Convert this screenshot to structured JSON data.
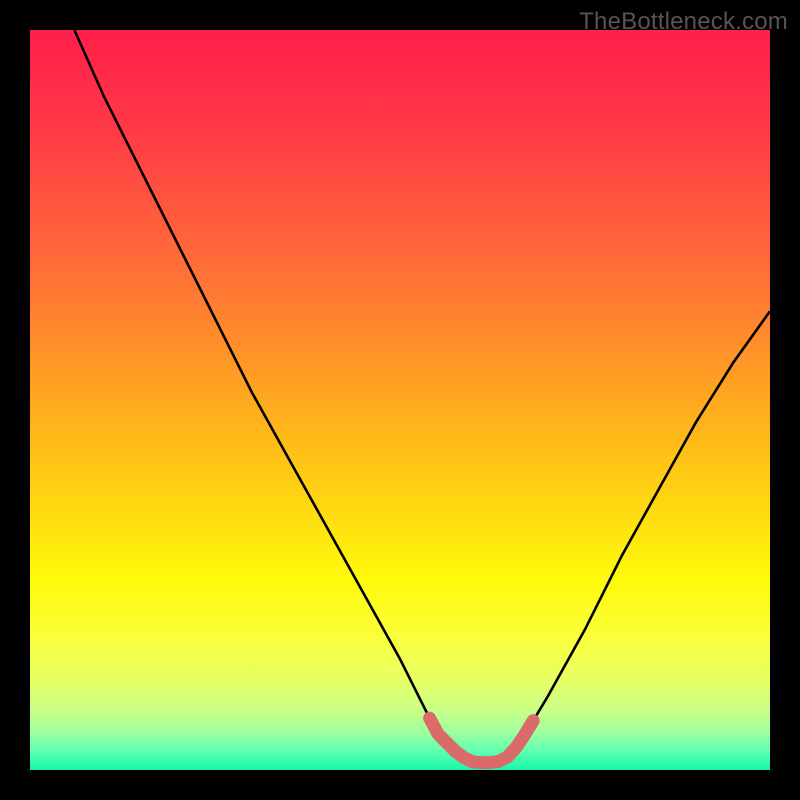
{
  "watermark": "TheBottleneck.com",
  "colors": {
    "page_bg": "#000000",
    "curve": "#000000",
    "highlight": "#db6b6b",
    "gradient_stops": [
      {
        "offset": 0.0,
        "color": "#ff1f4b"
      },
      {
        "offset": 0.12,
        "color": "#ff3646"
      },
      {
        "offset": 0.25,
        "color": "#ff5a3e"
      },
      {
        "offset": 0.38,
        "color": "#ff8030"
      },
      {
        "offset": 0.5,
        "color": "#ffa81f"
      },
      {
        "offset": 0.62,
        "color": "#ffd012"
      },
      {
        "offset": 0.74,
        "color": "#fff90a"
      },
      {
        "offset": 0.82,
        "color": "#faff3a"
      },
      {
        "offset": 0.88,
        "color": "#e6ff66"
      },
      {
        "offset": 0.92,
        "color": "#c8ff88"
      },
      {
        "offset": 0.95,
        "color": "#9cffa0"
      },
      {
        "offset": 0.975,
        "color": "#5effb2"
      },
      {
        "offset": 1.0,
        "color": "#16f7a8"
      }
    ]
  },
  "chart_data": {
    "type": "line",
    "title": "",
    "xlabel": "",
    "ylabel": "",
    "xlim": [
      0,
      100
    ],
    "ylim": [
      0,
      100
    ],
    "grid": false,
    "legend": false,
    "series": [
      {
        "name": "bottleneck-curve",
        "x": [
          6,
          10,
          15,
          20,
          25,
          30,
          35,
          40,
          45,
          50,
          53,
          55,
          58,
          60,
          63,
          65,
          67,
          70,
          75,
          80,
          85,
          90,
          95,
          100
        ],
        "y": [
          100,
          91,
          81,
          71,
          61,
          51,
          42,
          33,
          24,
          15,
          9,
          5,
          2,
          1,
          1,
          2,
          5,
          10,
          19,
          29,
          38,
          47,
          55,
          62
        ]
      }
    ],
    "highlight_range_x": [
      54,
      68
    ],
    "annotations": []
  }
}
